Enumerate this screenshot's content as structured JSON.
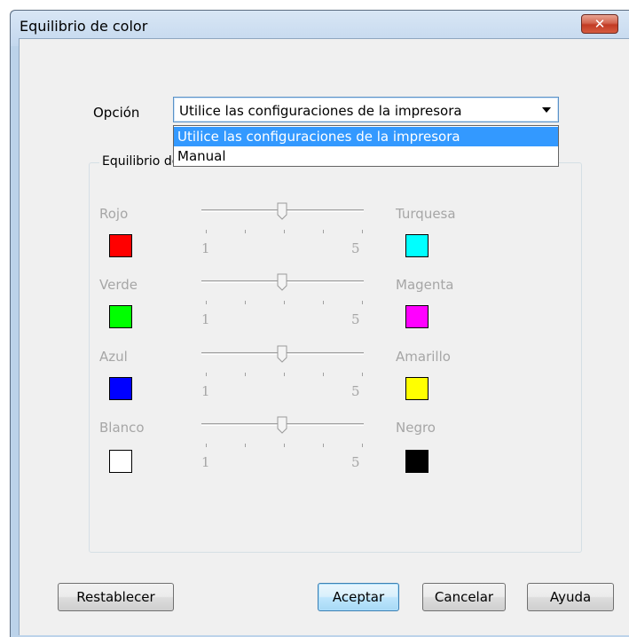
{
  "window": {
    "title": "Equilibrio de color",
    "close_label": "✕"
  },
  "option": {
    "label": "Opción",
    "selected": "Utilice las configuraciones de la impresora",
    "dropdown_items": [
      "Utilice las configuraciones de la impresora",
      "Manual"
    ]
  },
  "group": {
    "title": "Equilibrio de color",
    "rows": [
      {
        "left": "Rojo",
        "left_color": "#ff0000",
        "right": "Turquesa",
        "right_color": "#00ffff",
        "min": "1",
        "max": "5",
        "value": 3
      },
      {
        "left": "Verde",
        "left_color": "#00ff00",
        "right": "Magenta",
        "right_color": "#ff00ff",
        "min": "1",
        "max": "5",
        "value": 3
      },
      {
        "left": "Azul",
        "left_color": "#0000ff",
        "right": "Amarillo",
        "right_color": "#ffff00",
        "min": "1",
        "max": "5",
        "value": 3
      },
      {
        "left": "Blanco",
        "left_color": "#ffffff",
        "right": "Negro",
        "right_color": "#000000",
        "min": "1",
        "max": "5",
        "value": 3
      }
    ]
  },
  "buttons": {
    "reset": "Restablecer",
    "accept": "Aceptar",
    "cancel": "Cancelar",
    "help": "Ayuda"
  }
}
